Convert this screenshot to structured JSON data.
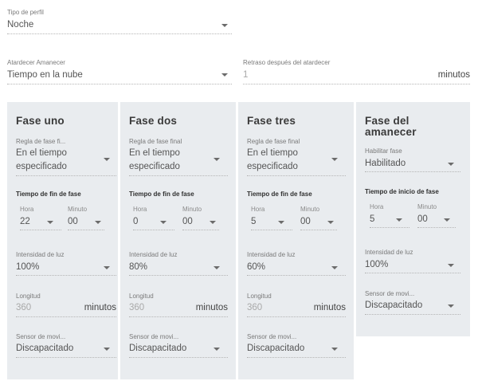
{
  "profile_type": {
    "label": "Tipo de perfil",
    "value": "Noche"
  },
  "sunset_sunrise": {
    "label": "Atardecer Amanecer",
    "value": "Tiempo en la nube"
  },
  "delay": {
    "label": "Retraso después del atardecer",
    "value": "1",
    "unit": "minutos"
  },
  "phases": [
    {
      "title": "Fase uno",
      "rule_label": "Regla de fase fi...",
      "rule_value_1": "En el tiempo",
      "rule_value_2": "especificado",
      "end_time_label": "Tiempo de fin de fase",
      "hour_label": "Hora",
      "hour_value": "22",
      "minute_label": "Minuto",
      "minute_value": "00",
      "light_label": "Intensidad de luz",
      "light_value": "100%",
      "length_label": "Longitud",
      "length_value": "360",
      "length_unit": "minutos",
      "sensor_label": "Sensor de movi...",
      "sensor_value": "Discapacitado"
    },
    {
      "title": "Fase dos",
      "rule_label": "Regla de fase final",
      "rule_value_1": "En el tiempo",
      "rule_value_2": "especificado",
      "end_time_label": "Tiempo de fin de fase",
      "hour_label": "Hora",
      "hour_value": "0",
      "minute_label": "Minuto",
      "minute_value": "00",
      "light_label": "Intensidad de luz",
      "light_value": "80%",
      "length_label": "Longitud",
      "length_value": "360",
      "length_unit": "minutos",
      "sensor_label": "Sensor de movi...",
      "sensor_value": "Discapacitado"
    },
    {
      "title": "Fase tres",
      "rule_label": "Regla de fase final",
      "rule_value_1": "En el tiempo",
      "rule_value_2": "especificado",
      "end_time_label": "Tiempo de fin de fase",
      "hour_label": "Hora",
      "hour_value": "5",
      "minute_label": "Minuto",
      "minute_value": "00",
      "light_label": "Intensidad de luz",
      "light_value": "60%",
      "length_label": "Longitud",
      "length_value": "360",
      "length_unit": "minutos",
      "sensor_label": "Sensor de movi...",
      "sensor_value": "Discapacitado"
    }
  ],
  "sunrise_phase": {
    "title_1": "Fase del",
    "title_2": "amanecer",
    "enable_label": "Habilitar fase",
    "enable_value": "Habilitado",
    "start_time_label": "Tiempo de inicio de fase",
    "hour_label": "Hora",
    "hour_value": "5",
    "minute_label": "Minuto",
    "minute_value": "00",
    "light_label": "Intensidad de luz",
    "light_value": "100%",
    "sensor_label": "Sensor de movi...",
    "sensor_value": "Discapacitado"
  }
}
